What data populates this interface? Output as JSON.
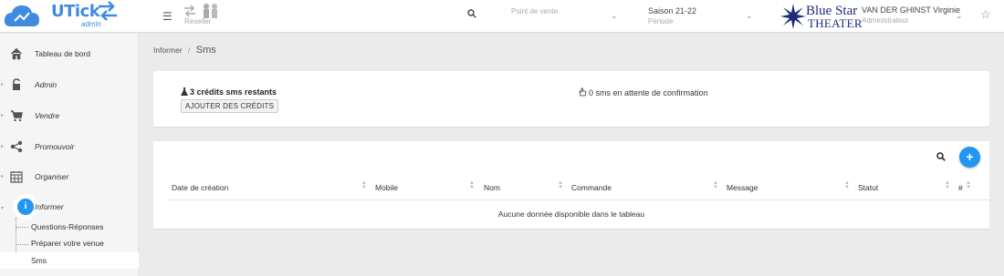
{
  "header": {
    "logo_text": "UTick",
    "logo_sub": "admin",
    "reseller_label": "Reseller",
    "point_de_vente_placeholder": "Point de vente",
    "season_value": "Saison 21-22",
    "season_label": "Période",
    "theater_line1": "Blue Star",
    "theater_line2": "THEATER",
    "user_name": "VAN DER GHINST Virginie",
    "user_role": "Administrateur"
  },
  "sidebar": {
    "items": [
      {
        "label": "Tableau de bord",
        "icon": "home-icon"
      },
      {
        "label": "Admin",
        "icon": "unlock-icon"
      },
      {
        "label": "Vendre",
        "icon": "cart-icon"
      },
      {
        "label": "Promouvoir",
        "icon": "share-icon"
      },
      {
        "label": "Organiser",
        "icon": "calendar-icon"
      },
      {
        "label": "Informer",
        "icon": "info-icon"
      }
    ],
    "sub_items": [
      {
        "label": "Questions-Réponses"
      },
      {
        "label": "Préparer votre venue"
      },
      {
        "label": "Sms"
      }
    ]
  },
  "breadcrumb": {
    "parent": "Informer",
    "separator": "/",
    "current": "Sms"
  },
  "sms_card": {
    "credits": "3 crédits sms restants",
    "add_button": "AJOUTER DES CRÉDITS",
    "pending": "0 sms en attente de confirmation"
  },
  "table": {
    "columns": [
      "Date de création",
      "Mobile",
      "Nom",
      "Commande",
      "Message",
      "Statut",
      "#"
    ],
    "add_symbol": "+",
    "empty_message": "Aucune donnée disponible dans le tableau"
  },
  "colors": {
    "accent": "#2196f3",
    "logo": "#3f8be0",
    "theater": "#1e2a78"
  }
}
